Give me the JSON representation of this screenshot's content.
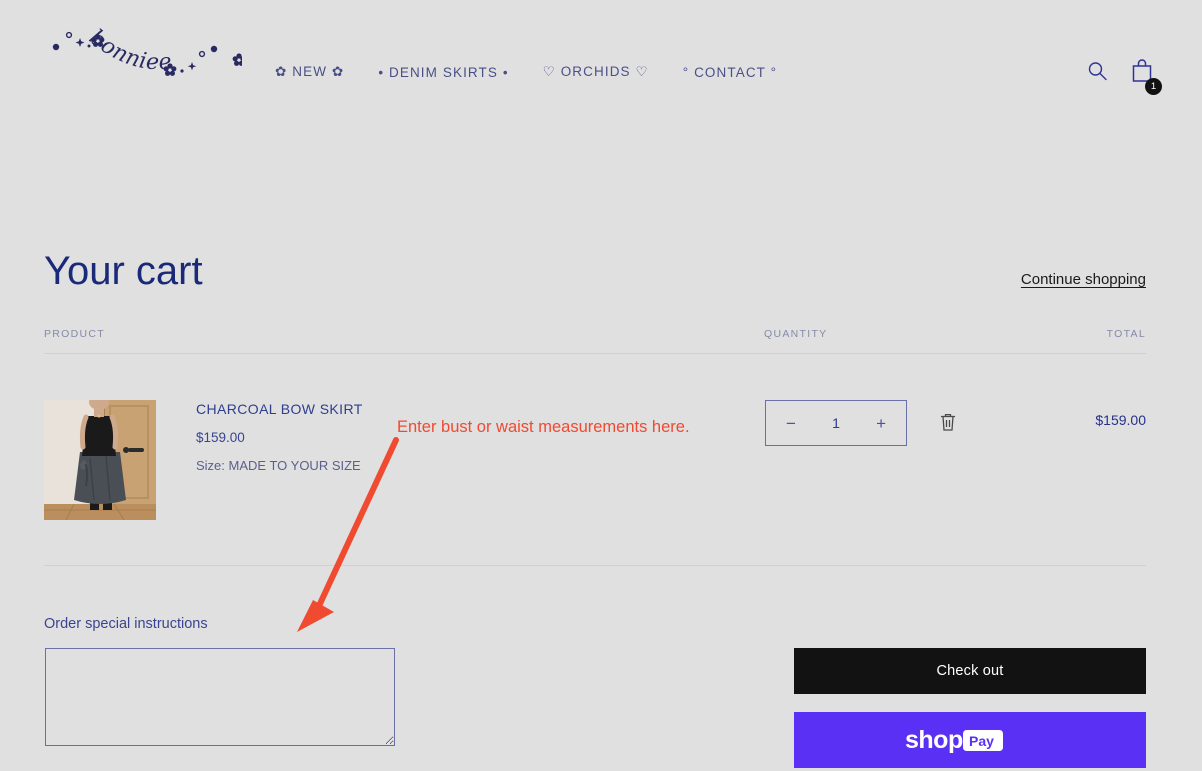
{
  "site": {
    "logo_text": "bonniee",
    "logo_color": "#2a2a63",
    "background_color": "#e0e0e0"
  },
  "header": {
    "nav": [
      {
        "label": "✿ NEW ✿",
        "name": "nav-new"
      },
      {
        "label": "• DENIM SKIRTS •",
        "name": "nav-denim-skirts"
      },
      {
        "label": "♡ ORCHIDS ♡",
        "name": "nav-orchids"
      },
      {
        "label": "° CONTACT °",
        "name": "nav-contact"
      }
    ],
    "search_icon": "search-icon",
    "cart_icon": "shopping-bag-icon",
    "cart_count": "1"
  },
  "cart": {
    "title": "Your cart",
    "continue_shopping": "Continue shopping",
    "columns": {
      "product": "PRODUCT",
      "quantity": "QUANTITY",
      "total": "TOTAL"
    },
    "items": [
      {
        "title": "CHARCOAL BOW SKIRT",
        "price": "$159.00",
        "variant": "Size: MADE TO YOUR SIZE",
        "quantity": "1",
        "total": "$159.00",
        "decrease_label": "−",
        "increase_label": "+",
        "remove_icon": "trash-icon"
      }
    ],
    "instructions_label": "Order special instructions",
    "instructions_value": "",
    "instructions_placeholder": ""
  },
  "actions": {
    "checkout_label": "Check out",
    "shop_pay_label": "shop Pay",
    "shop_pay_color": "#5a31f4",
    "checkout_color": "#121212"
  },
  "annotation": {
    "text": "Enter bust or waist measurements here.",
    "color": "#f04a30",
    "arrow_from": "397,440",
    "arrow_to": "300,630"
  }
}
